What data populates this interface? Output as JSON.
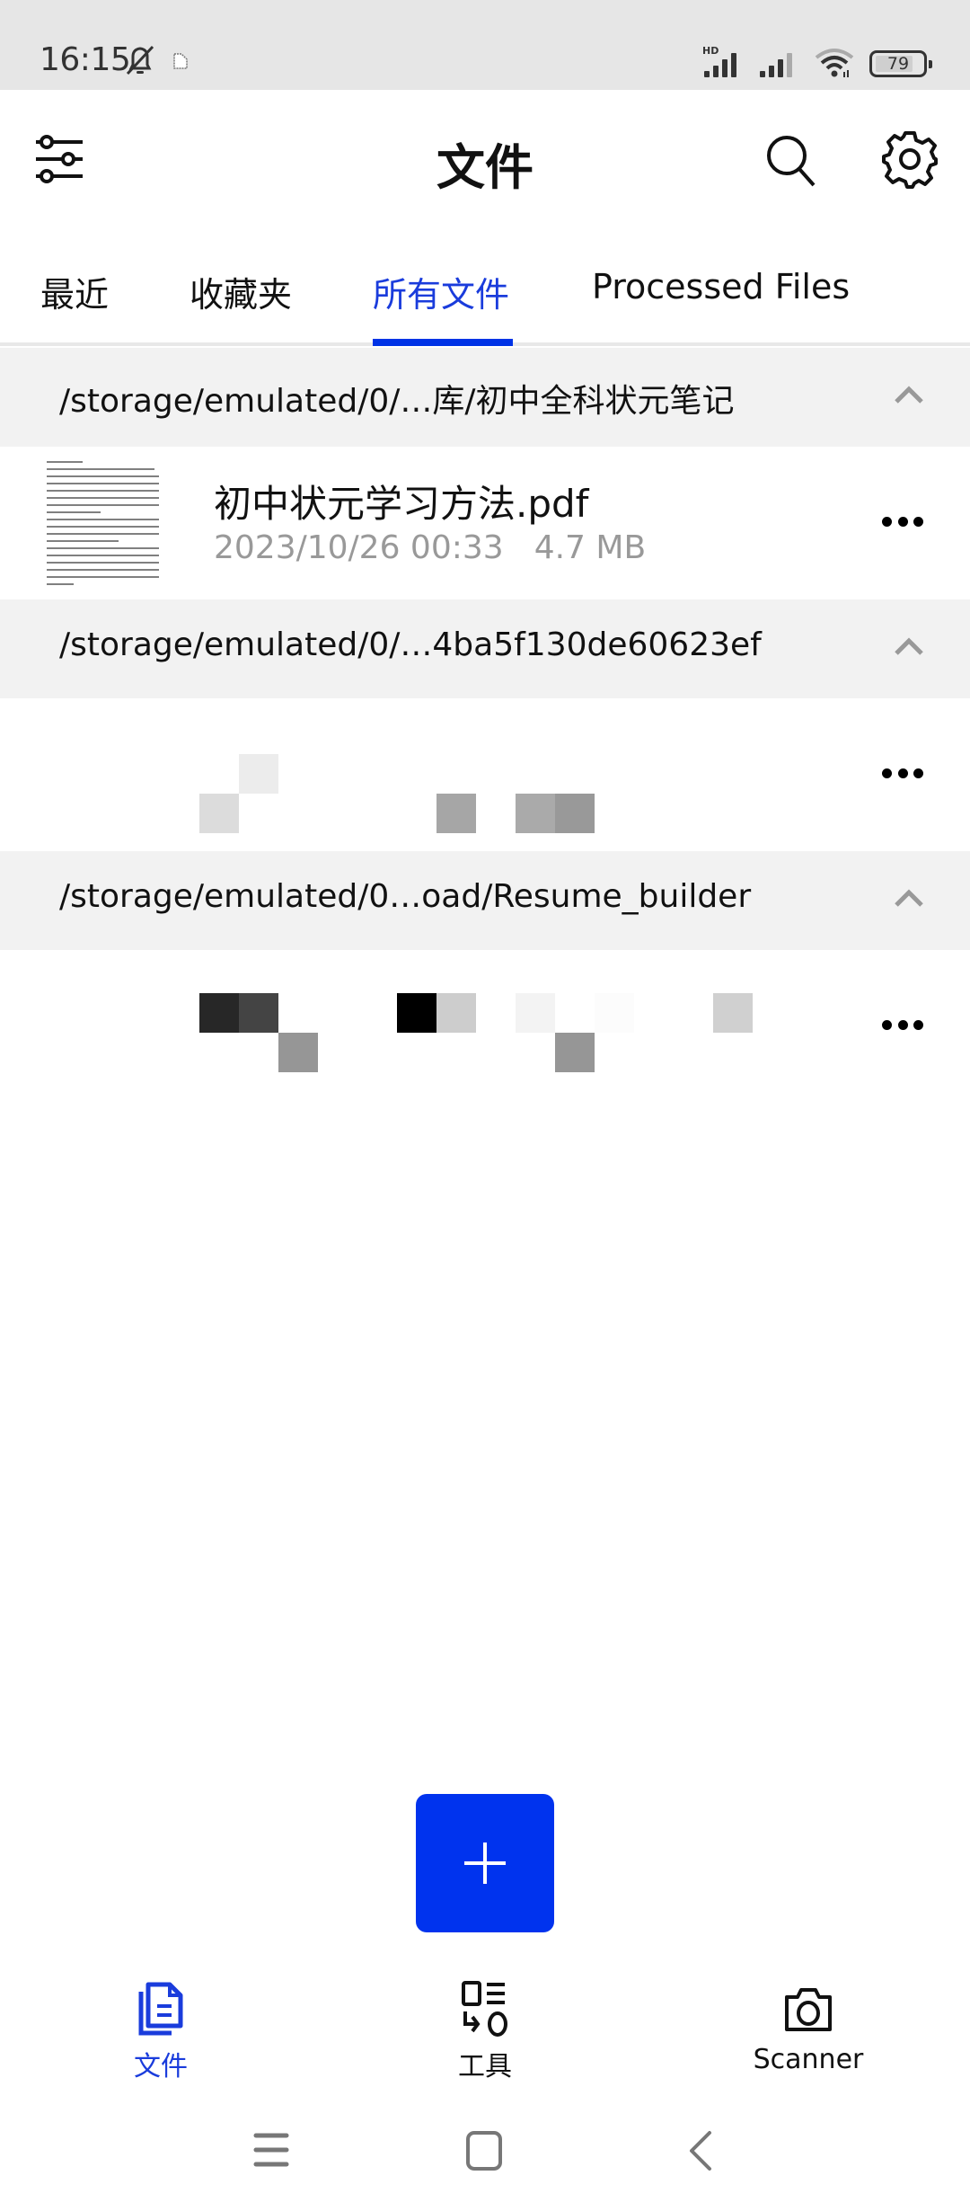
{
  "status_bar": {
    "time": "16:15",
    "icons": [
      "bell-muted-icon",
      "notification-icon",
      "hd-signal-icon",
      "signal-icon",
      "wifi-icon",
      "battery-icon"
    ],
    "signal_hd_label": "HD",
    "battery_level": "79"
  },
  "app_bar": {
    "title": "文件",
    "left_icon": "filter-sliders-icon",
    "right_icons": [
      "search-icon",
      "settings-gear-icon"
    ]
  },
  "tabs": [
    {
      "label": "最近",
      "active": false
    },
    {
      "label": "收藏夹",
      "active": false
    },
    {
      "label": "所有文件",
      "active": true
    },
    {
      "label": "Processed Files",
      "active": false
    }
  ],
  "groups": [
    {
      "path": "/storage/emulated/0/…库/初中全科状元笔记",
      "expanded": true,
      "files": [
        {
          "name": "初中状元学习方法.pdf",
          "date": "2023/10/26 00:33",
          "size": "4.7 MB"
        }
      ]
    },
    {
      "path": "/storage/emulated/0/…4ba5f130de60623ef",
      "expanded": true,
      "files": [
        {
          "name": "",
          "date": "",
          "size": ""
        }
      ]
    },
    {
      "path": "/storage/emulated/0…oad/Resume_builder",
      "expanded": true,
      "files": [
        {
          "name": "",
          "date": "",
          "size": ""
        }
      ]
    }
  ],
  "fab": {
    "icon": "plus-icon"
  },
  "bottom_nav": [
    {
      "label": "文件",
      "icon": "files-icon",
      "active": true
    },
    {
      "label": "工具",
      "icon": "tools-icon",
      "active": false
    },
    {
      "label": "Scanner",
      "icon": "camera-icon",
      "active": false
    }
  ],
  "system_nav": [
    "recents-icon",
    "home-icon",
    "back-icon"
  ],
  "colors": {
    "accent": "#0033ee",
    "active_tab_text": "#1a3cdc",
    "group_header_bg": "#f2f2f2",
    "status_bar_bg": "#e6e6e6",
    "meta_text": "#999999"
  }
}
